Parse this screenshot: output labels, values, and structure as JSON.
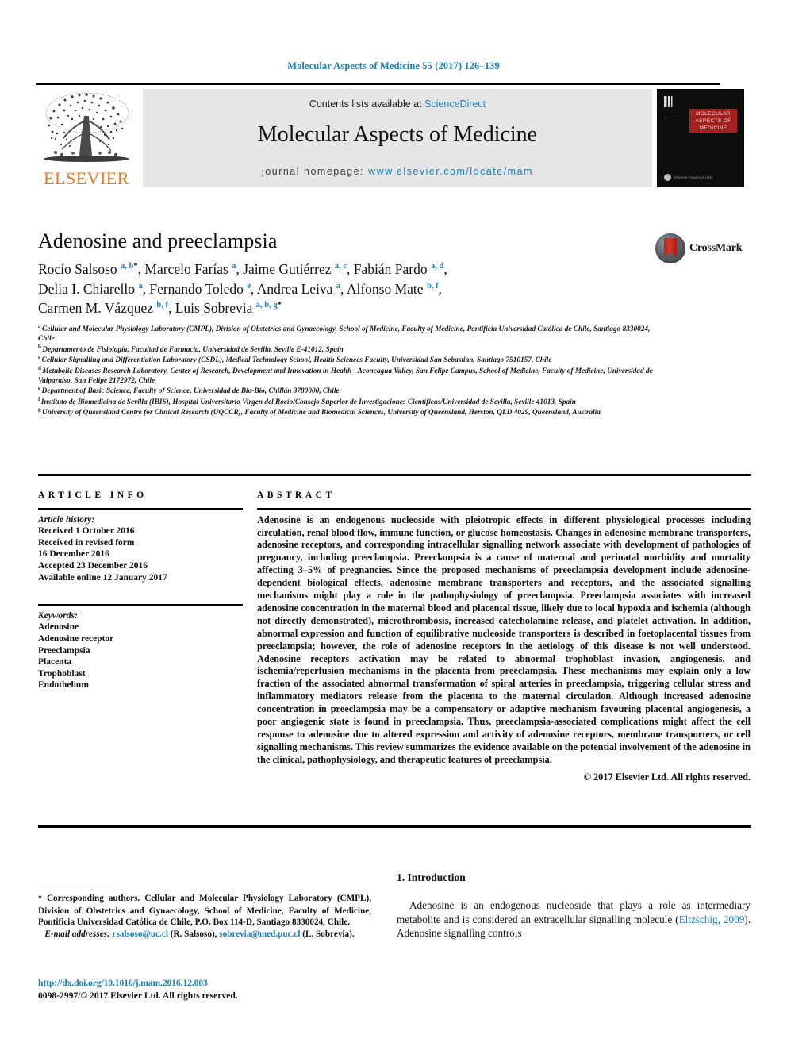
{
  "running_head": "Molecular Aspects of Medicine 55 (2017) 126–139",
  "masthead": {
    "contents_prefix": "Contents lists available at ",
    "contents_link": "ScienceDirect",
    "journal_title": "Molecular Aspects of Medicine",
    "homepage_prefix": "journal homepage: ",
    "homepage_url": "www.elsevier.com/locate/mam",
    "publisher": "ELSEVIER",
    "cover_title": "MOLECULAR ASPECTS OF MEDICINE",
    "cover_footer": "Elsevier Masson Italy"
  },
  "article": {
    "title": "Adenosine and preeclampsia",
    "crossmark_label": "CrossMark",
    "authors_html": "Rocío Salsoso <sup>a, b</sup><sup class=\"star\">*</sup>, Marcelo Farías <sup>a</sup>, Jaime Gutiérrez <sup>a, c</sup>, Fabián Pardo <sup>a, d</sup>,<br>Delia I. Chiarello <sup>a</sup>, Fernando Toledo <sup>e</sup>, Andrea Leiva <sup>a</sup>, Alfonso Mate <sup>b, f</sup>,<br>Carmen M. Vázquez <sup>b, f</sup>, Luis Sobrevia <sup>a, b, g</sup><sup class=\"star\">*</sup>"
  },
  "affiliations": [
    {
      "mark": "a",
      "text": "Cellular and Molecular Physiology Laboratory (CMPL), Division of Obstetrics and Gynaecology, School of Medicine, Faculty of Medicine, Pontificia Universidad Católica de Chile, Santiago 8330024, Chile"
    },
    {
      "mark": "b",
      "text": "Departamento de Fisiología, Facultad de Farmacia, Universidad de Sevilla, Seville E-41012, Spain"
    },
    {
      "mark": "c",
      "text": "Cellular Signalling and Differentiation Laboratory (CSDL), Medical Technology School, Health Sciences Faculty, Universidad San Sebastian, Santiago 7510157, Chile"
    },
    {
      "mark": "d",
      "text": "Metabolic Diseases Research Laboratory, Center of Research, Development and Innovation in Health - Aconcagua Valley, San Felipe Campus, School of Medicine, Faculty of Medicine, Universidad de Valparaíso, San Felipe 2172972, Chile"
    },
    {
      "mark": "e",
      "text": "Department of Basic Science, Faculty of Science, Universidad de Bio-Bio, Chillán 3780000, Chile"
    },
    {
      "mark": "f",
      "text": "Instituto de Biomedicina de Sevilla (IBIS), Hospital Universitario Virgen del Rocío/Consejo Superior de Investigaciones Científicas/Universidad de Sevilla, Seville 41013, Spain"
    },
    {
      "mark": "g",
      "text": "University of Queensland Centre for Clinical Research (UQCCR), Faculty of Medicine and Biomedical Sciences, University of Queensland, Herston, QLD 4029, Queensland, Australia"
    }
  ],
  "info": {
    "heading": "ARTICLE INFO",
    "history_label": "Article history:",
    "history": [
      "Received 1 October 2016",
      "Received in revised form",
      "16 December 2016",
      "Accepted 23 December 2016",
      "Available online 12 January 2017"
    ],
    "keywords_label": "Keywords:",
    "keywords": [
      "Adenosine",
      "Adenosine receptor",
      "Preeclampsia",
      "Placenta",
      "Trophoblast",
      "Endothelium"
    ]
  },
  "abstract": {
    "heading": "ABSTRACT",
    "body": "Adenosine is an endogenous nucleoside with pleiotropic effects in different physiological processes including circulation, renal blood flow, immune function, or glucose homeostasis. Changes in adenosine membrane transporters, adenosine receptors, and corresponding intracellular signalling network associate with development of pathologies of pregnancy, including preeclampsia. Preeclampsia is a cause of maternal and perinatal morbidity and mortality affecting 3–5% of pregnancies. Since the proposed mechanisms of preeclampsia development include adenosine-dependent biological effects, adenosine membrane transporters and receptors, and the associated signalling mechanisms might play a role in the pathophysiology of preeclampsia. Preeclampsia associates with increased adenosine concentration in the maternal blood and placental tissue, likely due to local hypoxia and ischemia (although not directly demonstrated), microthrombosis, increased catecholamine release, and platelet activation. In addition, abnormal expression and function of equilibrative nucleoside transporters is described in foetoplacental tissues from preeclampsia; however, the role of adenosine receptors in the aetiology of this disease is not well understood. Adenosine receptors activation may be related to abnormal trophoblast invasion, angiogenesis, and ischemia/reperfusion mechanisms in the placenta from preeclampsia. These mechanisms may explain only a low fraction of the associated abnormal transformation of spiral arteries in preeclampsia, triggering cellular stress and inflammatory mediators release from the placenta to the maternal circulation. Although increased adenosine concentration in preeclampsia may be a compensatory or adaptive mechanism favouring placental angiogenesis, a poor angiogenic state is found in preeclampsia. Thus, preeclampsia-associated complications might affect the cell response to adenosine due to altered expression and activity of adenosine receptors, membrane transporters, or cell signalling mechanisms. This review summarizes the evidence available on the potential involvement of the adenosine in the clinical, pathophysiology, and therapeutic features of preeclampsia.",
    "copyright": "© 2017 Elsevier Ltd. All rights reserved."
  },
  "footnote": {
    "star": "*",
    "corresponding": "Corresponding authors. Cellular and Molecular Physiology Laboratory (CMPL), Division of Obstetrics and Gynaecology, School of Medicine, Faculty of Medicine, Pontificia Universidad Católica de Chile, P.O. Box 114-D, Santiago 8330024, Chile.",
    "email_label": "E-mail addresses:",
    "email1": "rsalsoso@uc.cl",
    "email1_owner": "(R. Salsoso),",
    "email2": "sobrevia@med.puc.cl",
    "email2_owner": "(L. Sobrevia).",
    "doi": "http://dx.doi.org/10.1016/j.mam.2016.12.003",
    "issn": "0098-2997/© 2017 Elsevier Ltd. All rights reserved."
  },
  "introduction": {
    "heading": "1. Introduction",
    "paragraph_before_link": "Adenosine is an endogenous nucleoside that plays a role as intermediary metabolite and is considered an extracellular signalling molecule (",
    "link": "Eltzschig, 2009",
    "paragraph_after_link": "). Adenosine signalling controls"
  },
  "colors": {
    "link_blue": "#1a7fb5",
    "elsevier_orange": "#e87722",
    "band_gray": "#e6e6e6",
    "cover_red": "#a32020"
  }
}
